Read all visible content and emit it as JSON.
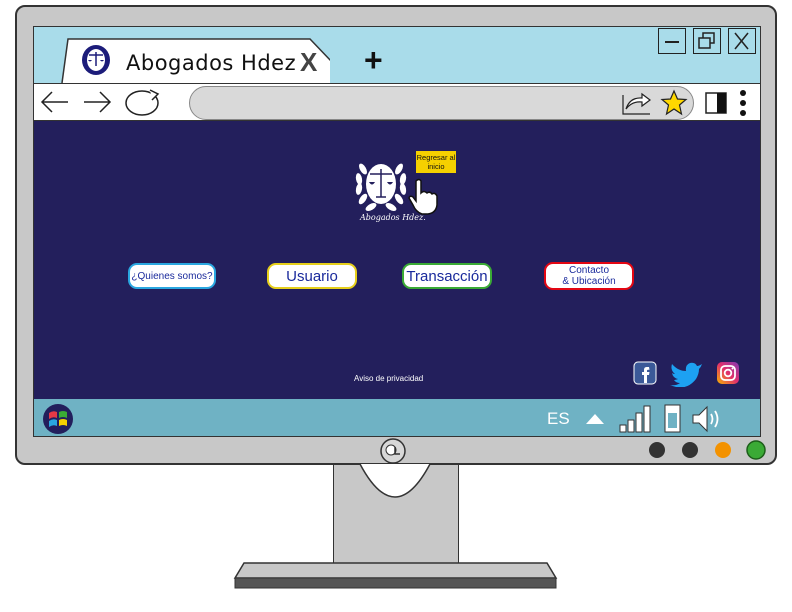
{
  "browser": {
    "tab_title": "Abogados  Hdez",
    "tab_close": "X",
    "new_tab": "+",
    "window_controls": [
      "minimize-icon",
      "restore-icon",
      "close-icon"
    ],
    "nav_icons": [
      "back-arrow-icon",
      "forward-arrow-icon",
      "reload-icon"
    ],
    "address_value": "",
    "toolbar_icons": [
      "share-icon",
      "star-icon",
      "sidebar-icon",
      "kebab-menu-icon"
    ]
  },
  "page": {
    "logo_caption": "Abogados Hdez.",
    "home_tag": "Regresar al inicio",
    "nav": {
      "about": "¿Quienes somos?",
      "user": "Usuario",
      "transaction": "Transacción",
      "contact_line1": "Contacto",
      "contact_line2": "& Ubicación"
    },
    "privacy_link": "Aviso de privacidad",
    "social": [
      "facebook-icon",
      "twitter-icon",
      "instagram-icon"
    ]
  },
  "taskbar": {
    "language": "ES",
    "icons": [
      "start-icon",
      "show-hidden-icon",
      "signal-icon",
      "battery-icon",
      "volume-icon"
    ]
  },
  "colors": {
    "page_bg": "#231f5c",
    "tabbar_bg": "#a9dcea",
    "taskbar_bg": "#6fb2c4",
    "about_border": "#2aa7e0",
    "user_border": "#e6cf1b",
    "transaction_border": "#3aaa35",
    "contact_border": "#e30613"
  }
}
